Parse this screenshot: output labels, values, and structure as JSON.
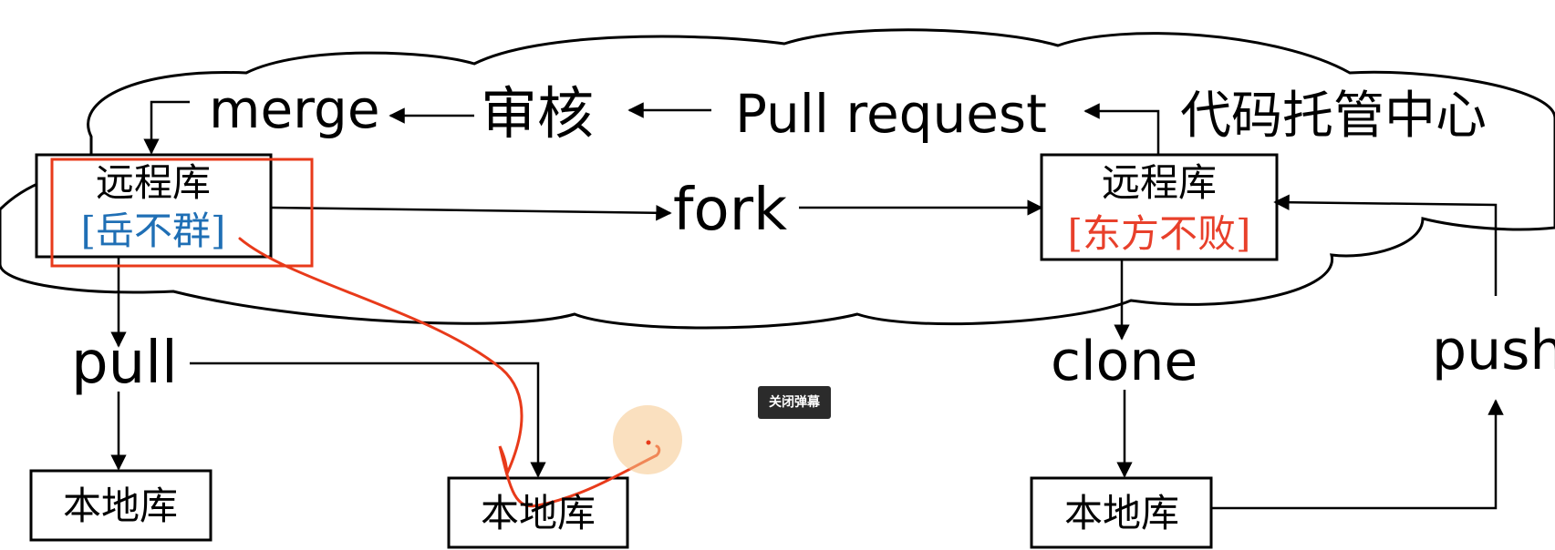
{
  "labels": {
    "merge": "merge",
    "review": "审核",
    "pull_request": "Pull request",
    "hosting_center": "代码托管中心",
    "fork": "fork",
    "pull": "pull",
    "clone": "clone",
    "push": "push"
  },
  "remote_left": {
    "title": "远程库",
    "owner": "[岳不群]"
  },
  "remote_right": {
    "title": "远程库",
    "owner": "[东方不败]"
  },
  "local_repos": {
    "left": "本地库",
    "middle": "本地库",
    "right": "本地库"
  },
  "overlay": {
    "close_danmaku": "关闭弹幕"
  },
  "colors": {
    "line": "#000000",
    "owner_left": "#1f6fb5",
    "owner_right": "#e8402b",
    "annotation": "#e83a1a",
    "cursor_highlight": "#f5c78a"
  }
}
